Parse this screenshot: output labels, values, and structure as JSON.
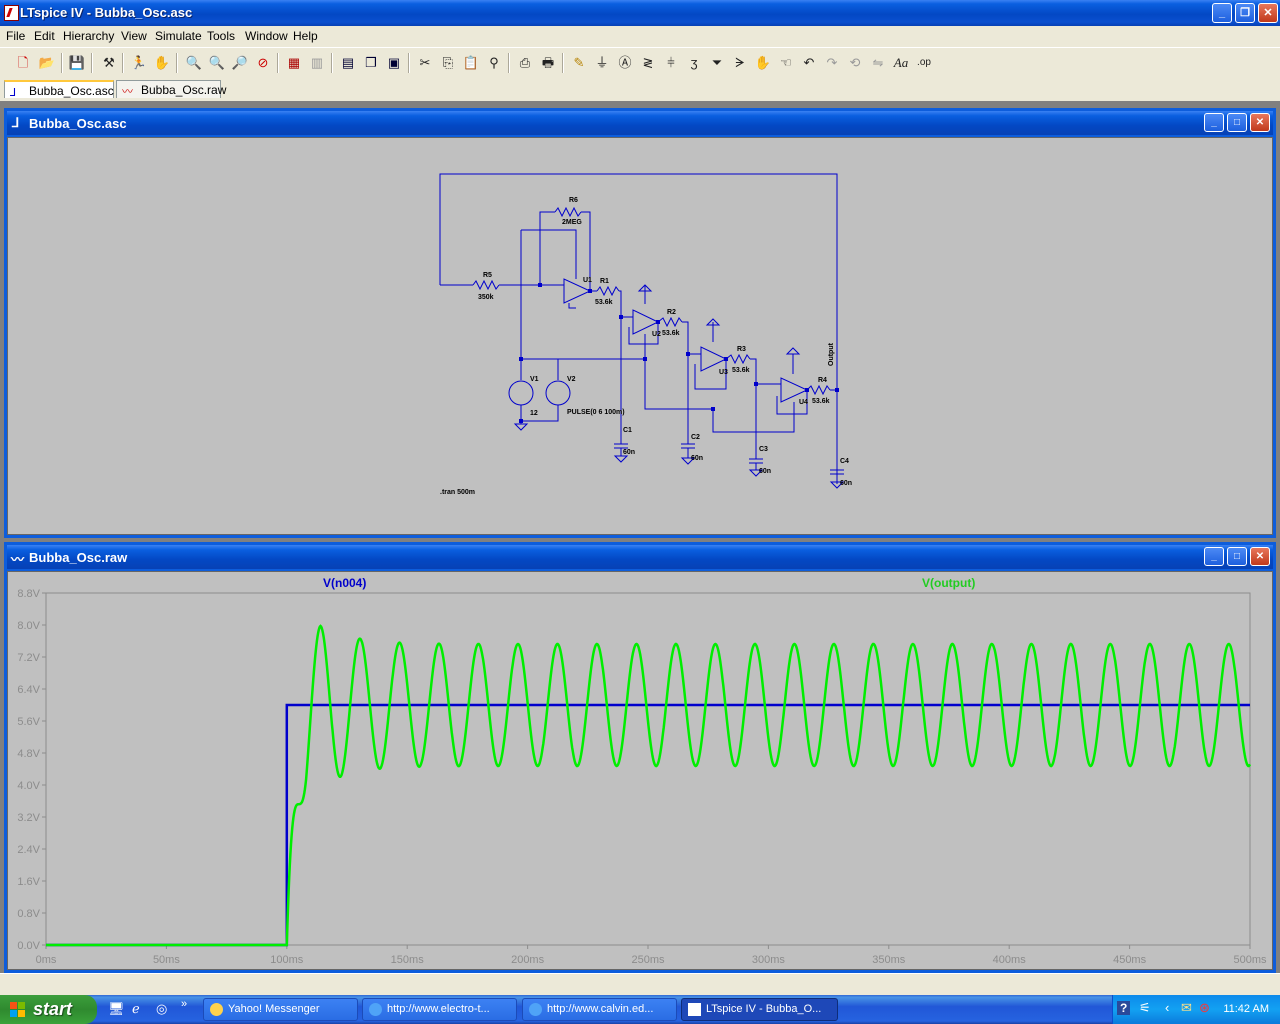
{
  "window": {
    "title": "LTspice IV - Bubba_Osc.asc"
  },
  "menu": [
    "File",
    "Edit",
    "Hierarchy",
    "View",
    "Simulate",
    "Tools",
    "Window",
    "Help"
  ],
  "menu_access": [
    "F",
    "E",
    "H",
    "V",
    "S",
    "T",
    "W",
    "H"
  ],
  "tabs": [
    {
      "label": "Bubba_Osc.asc",
      "icon": "schematic-icon",
      "active": true
    },
    {
      "label": "Bubba_Osc.raw",
      "icon": "waveform-icon",
      "active": false
    }
  ],
  "schematic_window": {
    "title": "Bubba_Osc.asc",
    "labels": {
      "r6": "R6",
      "r6_val": "2MEG",
      "r5": "R5",
      "r5_val": "350k",
      "u1": "U1",
      "r1": "R1",
      "r1_val": "53.6k",
      "r2": "R2",
      "r2_val": "53.6k",
      "u2": "U2",
      "r3": "R3",
      "r3_val": "53.6k",
      "u3": "U3",
      "r4": "R4",
      "r4_val": "53.6k",
      "u4": "U4",
      "v1": "V1",
      "v1_val": "12",
      "v2": "V2",
      "v2_val": "PULSE(0 6 100m)",
      "c1": "C1",
      "c1_val": "60n",
      "c2": "C2",
      "c2_val": "60n",
      "c3": "C3",
      "c3_val": "60n",
      "c4": "C4",
      "c4_val": "60n",
      "net_output": "Output",
      "directive": ".tran 500m"
    }
  },
  "plot_window": {
    "title": "Bubba_Osc.raw"
  },
  "chart_data": {
    "type": "line",
    "x_unit": "ms",
    "xlim": [
      0,
      500
    ],
    "ylim": [
      0.0,
      8.8
    ],
    "x_ticks": [
      "0ms",
      "50ms",
      "100ms",
      "150ms",
      "200ms",
      "250ms",
      "300ms",
      "350ms",
      "400ms",
      "450ms",
      "500ms"
    ],
    "y_ticks": [
      "0.0V",
      "0.8V",
      "1.6V",
      "2.4V",
      "3.2V",
      "4.0V",
      "4.8V",
      "5.6V",
      "6.4V",
      "7.2V",
      "8.0V",
      "8.8V"
    ],
    "series": [
      {
        "name": "V(n004)",
        "color": "#0000CC",
        "x": [
          0,
          100,
          100,
          500
        ],
        "values": [
          0.0,
          0.0,
          6.0,
          6.0
        ]
      },
      {
        "name": "V(output)",
        "color": "#00EE00",
        "description_points": {
          "start_ms": 100,
          "first_peak_ms": 114,
          "first_peak_v": 8.05,
          "first_trough_v": 4.3,
          "steady_max_v": 7.5,
          "steady_min_v": 4.45,
          "period_ms": 16.4,
          "offset_v": 6.0
        },
        "x": [
          0,
          100,
          103,
          106,
          110,
          114,
          118,
          122,
          126,
          130,
          134,
          138,
          142,
          146,
          150,
          500
        ],
        "values": [
          0.0,
          0.0,
          0.8,
          3.8,
          6.8,
          8.05,
          6.2,
          4.3,
          5.8,
          7.5,
          6.0,
          4.45,
          6.0,
          7.5,
          6.0,
          4.5
        ]
      }
    ]
  },
  "taskbar": {
    "start": "start",
    "tasks": [
      "Yahoo! Messenger",
      "http://www.electro-t...",
      "http://www.calvin.ed...",
      "LTspice IV - Bubba_O..."
    ],
    "clock": "11:42 AM"
  }
}
